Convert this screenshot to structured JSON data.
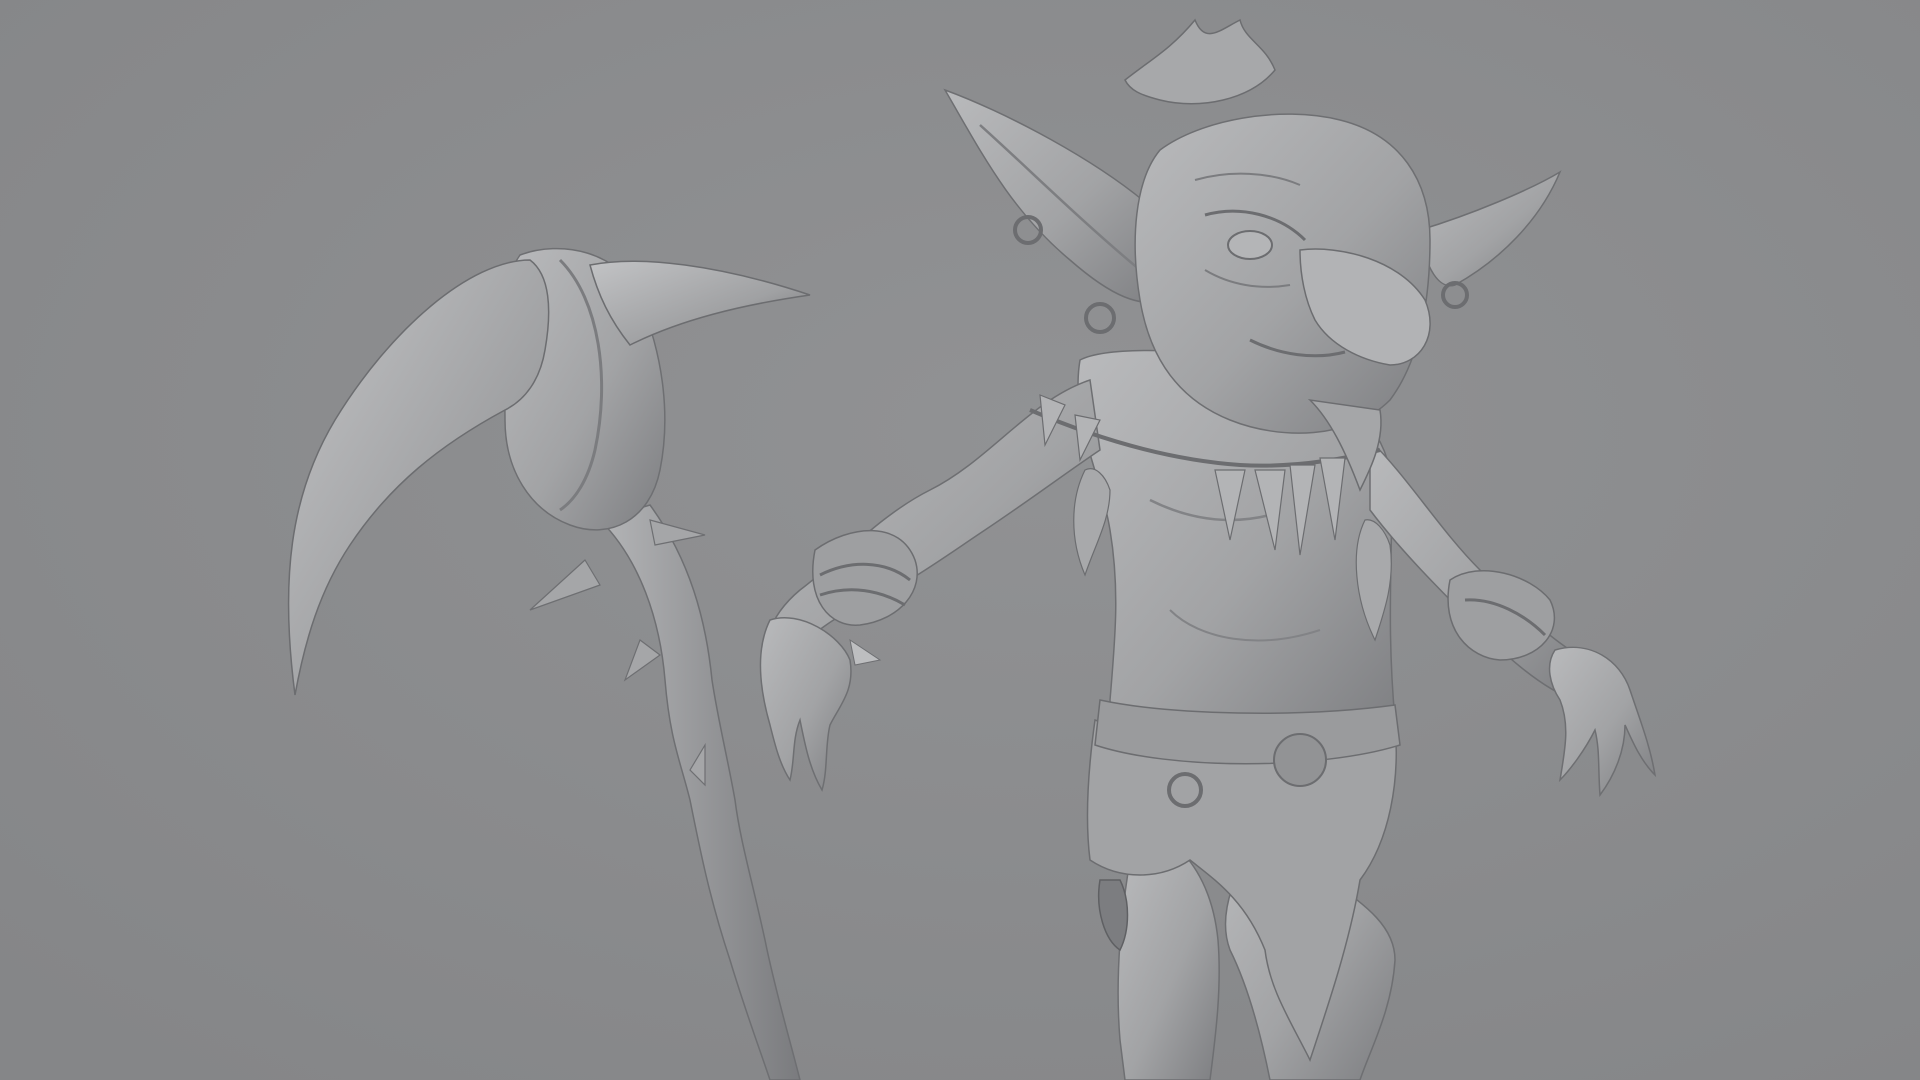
{
  "viewport": {
    "background_color": "#8b8c8e",
    "model_color": "#a4a5a7",
    "shadow_color": "#6c6d70",
    "highlight_color": "#c4c5c7",
    "subject": "goblin-sculpt-with-scythe"
  }
}
